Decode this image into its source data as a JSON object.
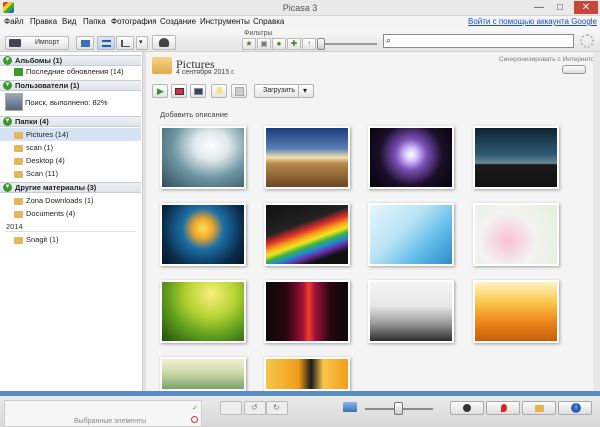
{
  "window": {
    "title": "Picasa 3",
    "minimize": "—",
    "maximize": "□",
    "close": "✕"
  },
  "menu": {
    "items": [
      "Файл",
      "Правка",
      "Вид",
      "Папка",
      "Фотография",
      "Создание",
      "Инструменты",
      "Справка"
    ],
    "signin": "Войти с помощью аккаунта Google"
  },
  "toolbar": {
    "import_label": "Импорт",
    "filters_label": "Фильтры",
    "search_placeholder": ""
  },
  "sidebar": {
    "albums": {
      "title": "Альбомы (1)",
      "items": [
        {
          "label": "Последние обновления (14)"
        }
      ]
    },
    "people": {
      "title": "Пользователи (1)",
      "items": [
        {
          "label": "Поиск, выполнено: 82%"
        }
      ]
    },
    "folders": {
      "title": "Папки (4)",
      "items": [
        {
          "label": "Pictures (14)"
        },
        {
          "label": "scan (1)"
        },
        {
          "label": "Desktop (4)"
        },
        {
          "label": "Scan (11)"
        }
      ]
    },
    "other": {
      "title": "Другие материалы (3)",
      "items": [
        {
          "label": "Zona Downloads (1)"
        },
        {
          "label": "Documents (4)"
        }
      ]
    },
    "year_label": "2014",
    "year_items": [
      {
        "label": "Snagit (1)"
      }
    ]
  },
  "album": {
    "title": "Pictures",
    "date": "4 сентября 2015 г.",
    "sync_label": "Синхронизировать с Интернетом",
    "upload_label": "Загрузить",
    "add_description": "Добавить описание"
  },
  "tray": {
    "selected_label": "Выбранные элементы"
  },
  "colors": {
    "accent_green": "#3c9a2d",
    "link_blue": "#1a4bcc",
    "status_bar_blue": "#5c8cc4"
  }
}
